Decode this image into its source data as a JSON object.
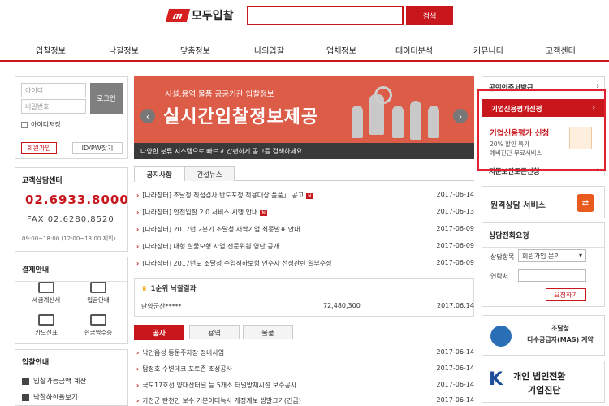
{
  "header": {
    "logo_mark": "m",
    "logo_text": "모두입찰",
    "search_value": "",
    "search_btn": "검색"
  },
  "nav": [
    "입찰정보",
    "낙찰정보",
    "맞춤정보",
    "나의입찰",
    "업체정보",
    "데이터분석",
    "커뮤니티",
    "고객센터"
  ],
  "login": {
    "id_ph": "아이디",
    "pw_ph": "비밀번호",
    "btn": "로그인",
    "save": "아이디저장",
    "join": "회원가입",
    "find": "ID/PW찾기"
  },
  "cs": {
    "title": "고객상담센터",
    "phone": "02.6933.8000",
    "fax": "FAX 02.6280.8520",
    "hours": "09:00~18:00 (12:00~13:00 제외)"
  },
  "pay": {
    "title": "결제안내",
    "items": [
      "세금계산서",
      "입금안내",
      "카드전표",
      "현금영수증"
    ]
  },
  "guide": {
    "title": "입찰안내",
    "items": [
      "입찰가능금액 계산",
      "낙찰하한율보기"
    ]
  },
  "banner": {
    "sub": "시설,용역,물품 공공기관 입찰정보",
    "main": "실시간입찰정보제공",
    "foot": "다양한 분류 시스템으로 빠르고 간편하게 공고를 검색하세요"
  },
  "tabs1": [
    "공지사항",
    "건설뉴스"
  ],
  "notices": [
    {
      "t": "[나라장터] 조달청 직접검사 반도포정 적용대상 품품」 공고",
      "d": "2017-06-14",
      "n": true
    },
    {
      "t": "[나라장터] 안전입찰 2.0 서비스 시행 안내",
      "d": "2017-06-13",
      "n": true
    },
    {
      "t": "[나라장터] 2017년 2분기 조달청 새싹기업 최종발표 안내",
      "d": "2017-06-09",
      "n": false
    },
    {
      "t": "[나라장터] 대형 실물모형 사업 전문위원 영단 공개",
      "d": "2017-06-09",
      "n": false
    },
    {
      "t": "[나라장터] 2017년도 조달청 수입적하보험 인수사 선정관련 일부수정",
      "d": "2017-06-09",
      "n": false
    }
  ],
  "badge": "N",
  "bid": {
    "title": "1순위 낙찰결과",
    "name": "단양군산*****",
    "amount": "72,480,300",
    "date": "2017.06.14"
  },
  "tabs2": [
    "공사",
    "용역",
    "물품"
  ],
  "works": [
    {
      "t": "낙안읍성 등문주차장 정비사업",
      "d": "2017-06-14"
    },
    {
      "t": "탐정호 수변데크 포토존 조성공사",
      "d": "2017-06-14"
    },
    {
      "t": "국도17호선 양대산터널 등 5개소 터널방재시설 보수공사",
      "d": "2017-06-14"
    },
    {
      "t": "가천군 탄천인 보수 기분이터녹사 개정계보 쌍발크기(긴급)",
      "d": "2017-06-14"
    }
  ],
  "right": {
    "r1": "공인인증서발급",
    "credit_head": "기업신용평가신청",
    "credit_title": "기업신용평가 신청",
    "credit_l1": "20% 할인 특가",
    "credit_l2": "예비진단 무료서비스",
    "r3": "지문보안토큰신청",
    "remote": "원격상담 서비스",
    "req_title": "상담전화요청",
    "req_item": "상담항목",
    "req_sel": "회원가입 문의",
    "req_contact": "연락처",
    "req_btn": "요청하기",
    "mas1": "조달청",
    "mas2": "다수공급자(MAS) 계약",
    "indv1": "개인 법인전환",
    "indv2": "기업진단"
  }
}
